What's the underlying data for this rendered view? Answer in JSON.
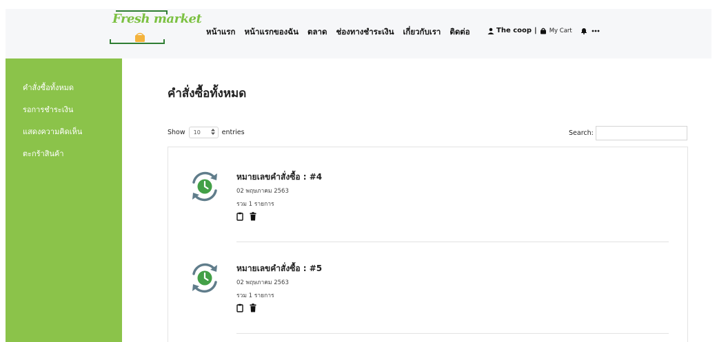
{
  "brand": {
    "logo_text": "Fresh market",
    "green": "#7cc142",
    "sidebar_green": "#8bc34a"
  },
  "nav": {
    "items": [
      {
        "label": "หน้าแรก"
      },
      {
        "label": "หน้าแรกของฉัน"
      },
      {
        "label": "ตลาด"
      },
      {
        "label": "ช่องทางชำระเงิน"
      },
      {
        "label": "เกี่ยวกับเรา"
      },
      {
        "label": "ติดต่อ"
      }
    ]
  },
  "user": {
    "name": "The coop",
    "separator": "|",
    "cart_label": "My Cart",
    "icons": [
      "user-icon",
      "bag-icon",
      "bell-icon",
      "more-icon"
    ]
  },
  "sidebar": {
    "items": [
      {
        "label": "คำสั่งซื้อทั้งหมด"
      },
      {
        "label": "รอการชำระเงิน"
      },
      {
        "label": "แสดงความคิดเห็น"
      },
      {
        "label": "ตะกร้าสินค้า"
      }
    ]
  },
  "main": {
    "title": "คำสั่งซื้อทั้งหมด",
    "show_label": "Show",
    "entries_value": "10",
    "entries_label": "entries",
    "search_label": "Search:",
    "search_value": ""
  },
  "orders": [
    {
      "title": "หมายเลขคำสั่งซื้อ : #4",
      "date": "02 พฤษภาคม 2563",
      "total": "รวม 1 รายการ",
      "icons": [
        "clock-refresh-icon",
        "clipboard-icon",
        "trash-icon"
      ]
    },
    {
      "title": "หมายเลขคำสั่งซื้อ : #5",
      "date": "02 พฤษภาคม 2563",
      "total": "รวม 1 รายการ",
      "icons": [
        "clock-refresh-icon",
        "clipboard-icon",
        "trash-icon"
      ]
    }
  ]
}
